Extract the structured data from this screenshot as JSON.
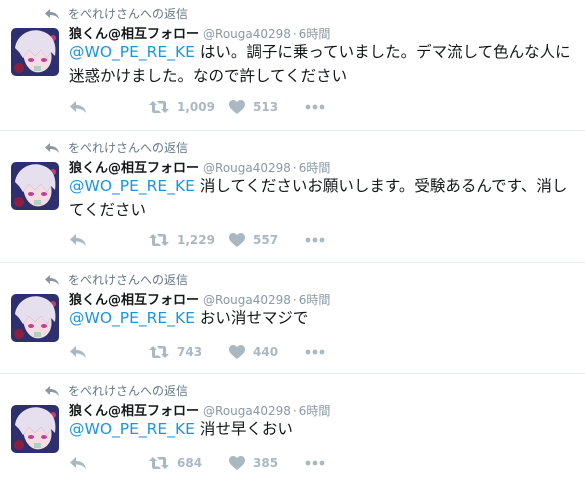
{
  "tweets": [
    {
      "context": "をぺれけさんへの返信",
      "fullname": "狼くん@相互フォロー",
      "username": "@Rouga40298",
      "sep": "·",
      "time": "6時間",
      "mention": "@WO_PE_RE_KE",
      "text": " はい。調子に乗っていました。デマ流して色んな人に迷惑かけました。なので許してください",
      "retweets": "1,009",
      "likes": "513"
    },
    {
      "context": "をぺれけさんへの返信",
      "fullname": "狼くん@相互フォロー",
      "username": "@Rouga40298",
      "sep": "·",
      "time": "6時間",
      "mention": "@WO_PE_RE_KE",
      "text": " 消してくださいお願いします。受験あるんです、消してください",
      "retweets": "1,229",
      "likes": "557"
    },
    {
      "context": "をぺれけさんへの返信",
      "fullname": "狼くん@相互フォロー",
      "username": "@Rouga40298",
      "sep": "·",
      "time": "6時間",
      "mention": "@WO_PE_RE_KE",
      "text": " おい消せマジで",
      "retweets": "743",
      "likes": "440"
    },
    {
      "context": "をぺれけさんへの返信",
      "fullname": "狼くん@相互フォロー",
      "username": "@Rouga40298",
      "sep": "·",
      "time": "6時間",
      "mention": "@WO_PE_RE_KE",
      "text": " 消せ早くおい",
      "retweets": "684",
      "likes": "385"
    }
  ],
  "icons": {
    "reply": "reply-icon",
    "retweet": "retweet-icon",
    "like": "heart-icon",
    "more": "more-icon"
  },
  "colors": {
    "mention": "#1b95e0",
    "meta": "#8899a6",
    "action": "#aab8c2",
    "divider": "#e6ecf0"
  }
}
